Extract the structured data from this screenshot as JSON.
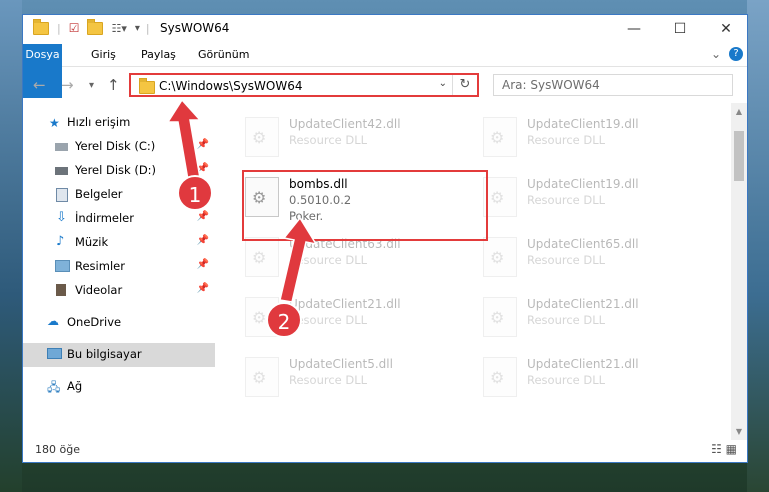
{
  "window": {
    "title": "SysWOW64",
    "controls": {
      "minimize": "—",
      "maximize": "☐",
      "close": "✕"
    }
  },
  "ribbon": {
    "tabs": [
      "Dosya",
      "Giriş",
      "Paylaş",
      "Görünüm"
    ],
    "help_icon": "?",
    "collapse_icon": "⌄"
  },
  "address": {
    "path": "C:\\Windows\\SysWOW64",
    "search_placeholder": "Ara: SysWOW64"
  },
  "nav": {
    "items": [
      {
        "label": "Hızlı erişim",
        "icon": "star-icon",
        "pin": false
      },
      {
        "label": "Yerel Disk (C:)",
        "icon": "drive-icon",
        "pin": true
      },
      {
        "label": "Yerel Disk (D:)",
        "icon": "drive-icon",
        "pin": true
      },
      {
        "label": "Belgeler",
        "icon": "document-icon",
        "pin": true
      },
      {
        "label": "İndirmeler",
        "icon": "download-icon",
        "pin": true
      },
      {
        "label": "Müzik",
        "icon": "music-icon",
        "pin": true
      },
      {
        "label": "Resimler",
        "icon": "picture-icon",
        "pin": true
      },
      {
        "label": "Videolar",
        "icon": "video-icon",
        "pin": true
      },
      {
        "label": "OneDrive",
        "icon": "cloud-icon",
        "pin": false
      },
      {
        "label": "Bu bilgisayar",
        "icon": "computer-icon",
        "pin": false
      },
      {
        "label": "Ağ",
        "icon": "network-icon",
        "pin": false
      }
    ]
  },
  "files": {
    "left": [
      {
        "name": "UpdateClient42.dll",
        "sub": "Resource DLL"
      },
      {
        "name": "bombs.dll",
        "sub": "0.5010.0.2",
        "sub2": "Poker."
      },
      {
        "name": "UpdateClient63.dll",
        "sub": "Resource DLL"
      },
      {
        "name": "UpdateClient21.dll",
        "sub": "Resource DLL"
      },
      {
        "name": "UpdateClient5.dll",
        "sub": "Resource DLL"
      }
    ],
    "right": [
      {
        "name": "UpdateClient19.dll",
        "sub": "Resource DLL"
      },
      {
        "name": "UpdateClient19.dll",
        "sub": "Resource DLL"
      },
      {
        "name": "UpdateClient65.dll",
        "sub": "Resource DLL"
      },
      {
        "name": "UpdateClient21.dll",
        "sub": "Resource DLL"
      },
      {
        "name": "UpdateClient21.dll",
        "sub": "Resource DLL"
      }
    ]
  },
  "status": {
    "count": "180 öğe"
  },
  "callouts": [
    "1",
    "2"
  ],
  "colors": {
    "accent": "#1979ca",
    "highlight": "#e33b3b"
  }
}
